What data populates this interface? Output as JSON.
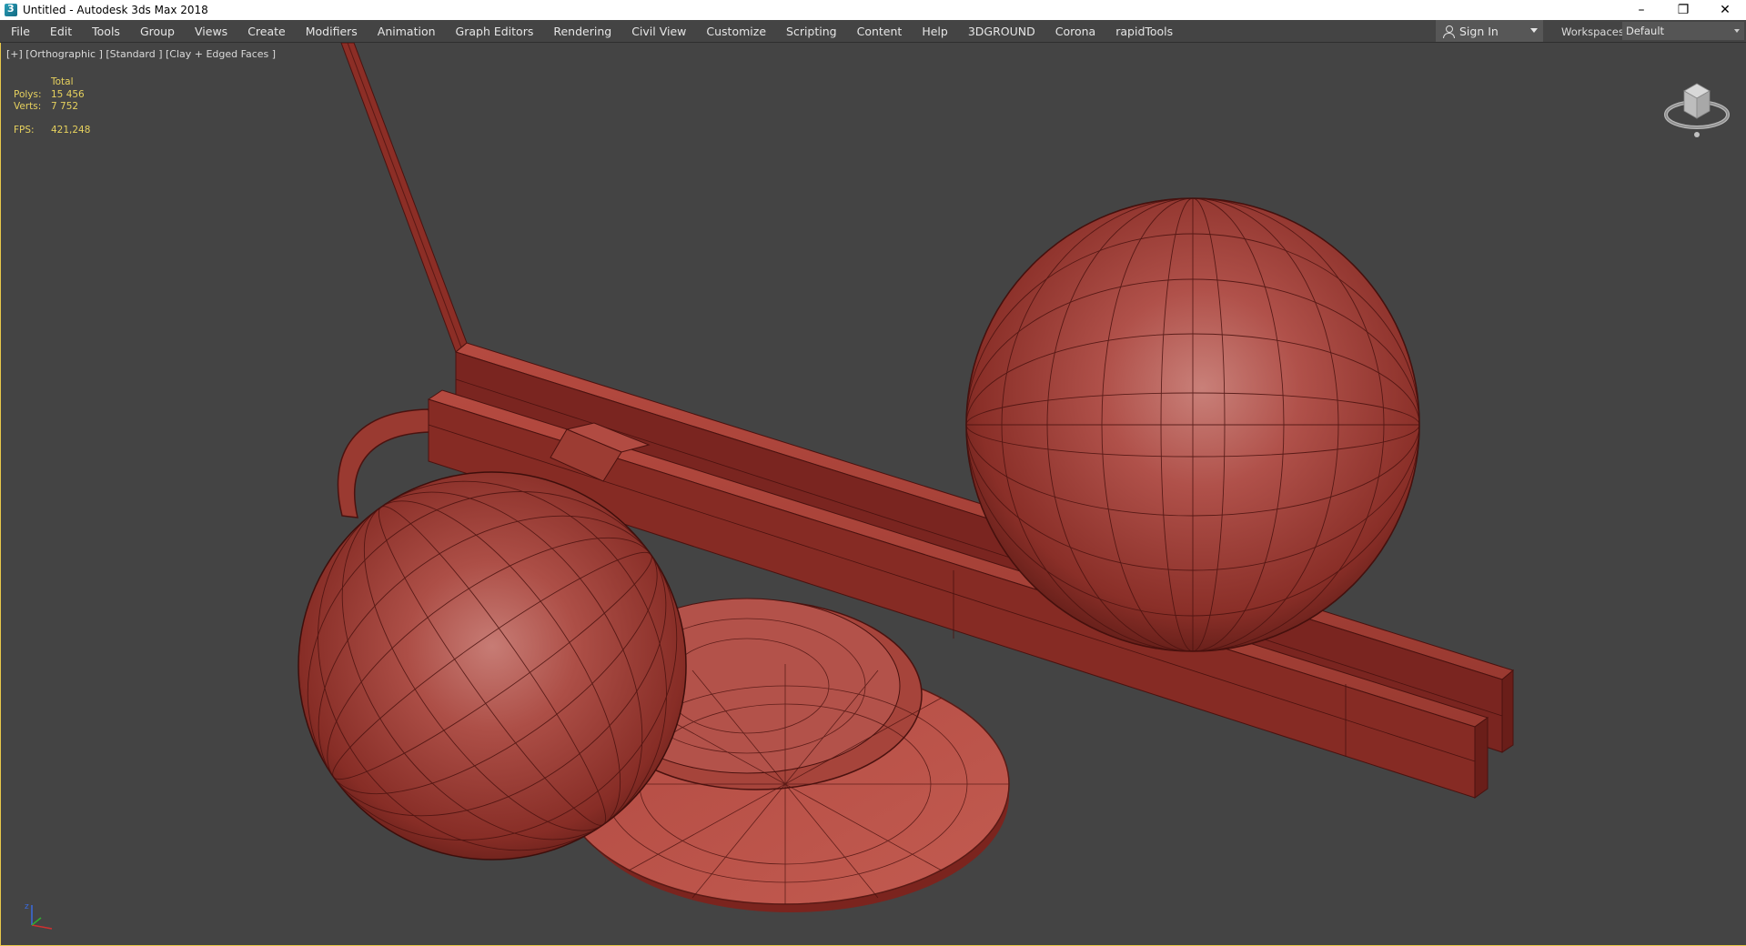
{
  "window": {
    "title": "Untitled - Autodesk 3ds Max 2018",
    "minimize": "–",
    "restore": "❐",
    "close": "✕"
  },
  "menu": [
    "File",
    "Edit",
    "Tools",
    "Group",
    "Views",
    "Create",
    "Modifiers",
    "Animation",
    "Graph Editors",
    "Rendering",
    "Civil View",
    "Customize",
    "Scripting",
    "Content",
    "Help",
    "3DGROUND",
    "Corona",
    "rapidTools"
  ],
  "signin": {
    "label": "Sign In"
  },
  "workspaces": {
    "label": "Workspaces:",
    "value": "Default"
  },
  "viewport": {
    "label": "[+] [Orthographic ] [Standard ] [Clay + Edged Faces ]",
    "stats": {
      "total_label": "Total",
      "polys_label": "Polys:",
      "polys_value": "15 456",
      "verts_label": "Verts:",
      "verts_value": "7 752",
      "fps_label": "FPS:",
      "fps_value": "421,248"
    }
  },
  "colors": {
    "accent": "#e8c84a",
    "clay": "#a8453c",
    "background": "#444444"
  }
}
